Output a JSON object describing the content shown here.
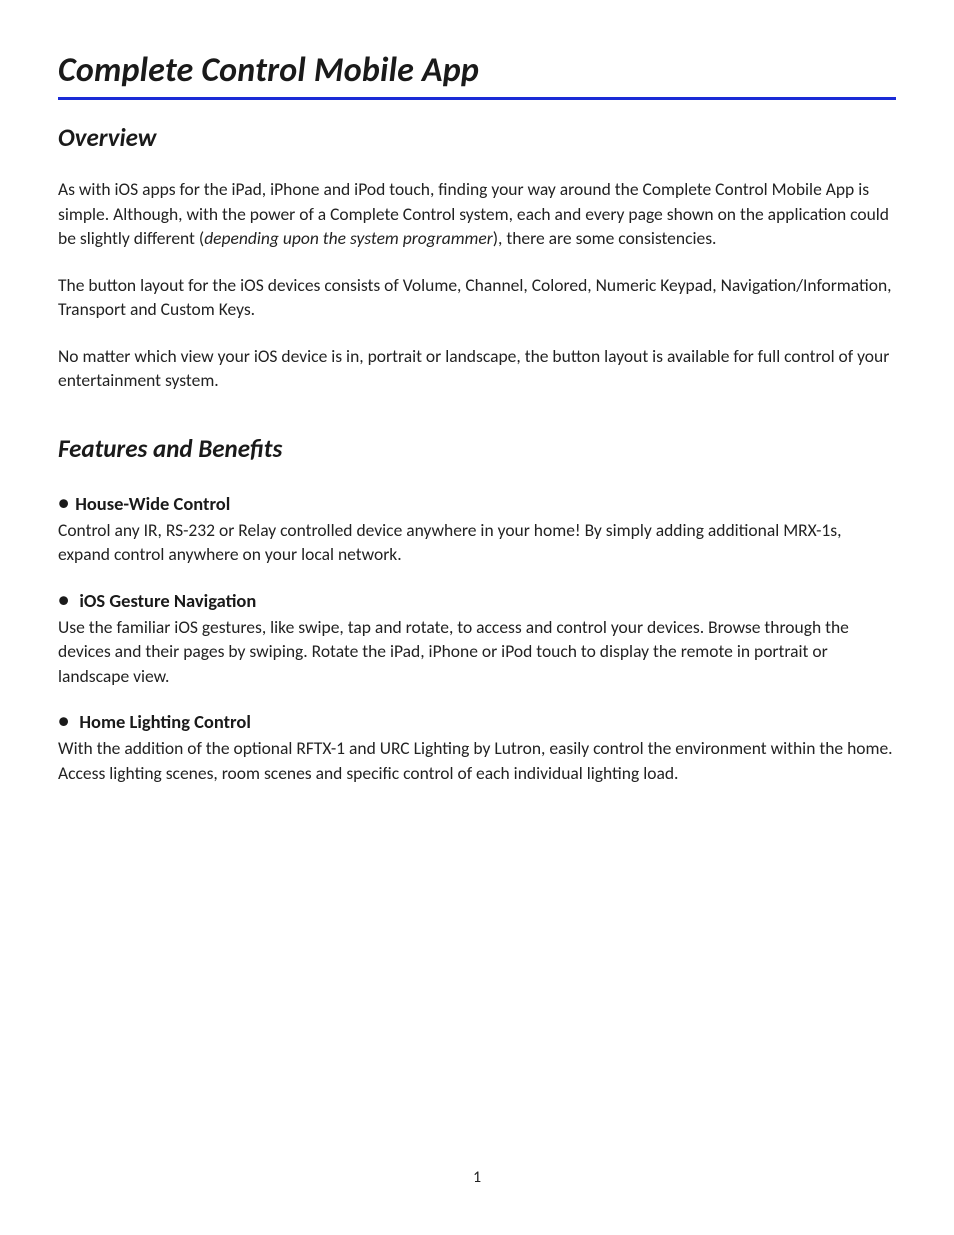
{
  "doc": {
    "title": "Complete Control Mobile App",
    "page_number": "1"
  },
  "overview": {
    "heading": "Overview",
    "p1_a": "As with iOS apps for the iPad, iPhone and iPod touch, finding your way around the Complete Control Mobile App is simple. Although, with the power of a Complete Control system, each and every page shown on the application could be slightly different (",
    "p1_i": "depending upon the system programmer",
    "p1_b": "), there are some consistencies.",
    "p2": "The button layout for the iOS devices consists of Volume, Channel, Colored, Numeric Keypad, Navigation/Information, Transport and Custom Keys.",
    "p3": "No matter which view your iOS device is in, portrait or landscape, the button layout is available for full control of your entertainment system."
  },
  "features": {
    "heading": "Features and Benefits",
    "items": [
      {
        "title": "House-Wide Control",
        "body": "Control any IR, RS-232 or Relay controlled device anywhere in your home! By simply adding additional MRX-1s, expand control anywhere on your local network."
      },
      {
        "title": "iOS Gesture Navigation",
        "body": "Use the familiar iOS  gestures, like swipe, tap and rotate, to access and control your devices.  Browse through the devices and their pages by swiping.  Rotate the iPad, iPhone or iPod touch to display the remote in portrait or landscape view."
      },
      {
        "title": "Home Lighting Control",
        "body": "With the addition of the optional RFTX-1 and URC Lighting by Lutron, easily control the environment within the home. Access lighting scenes, room scenes and specific control of each individual lighting load."
      }
    ]
  }
}
